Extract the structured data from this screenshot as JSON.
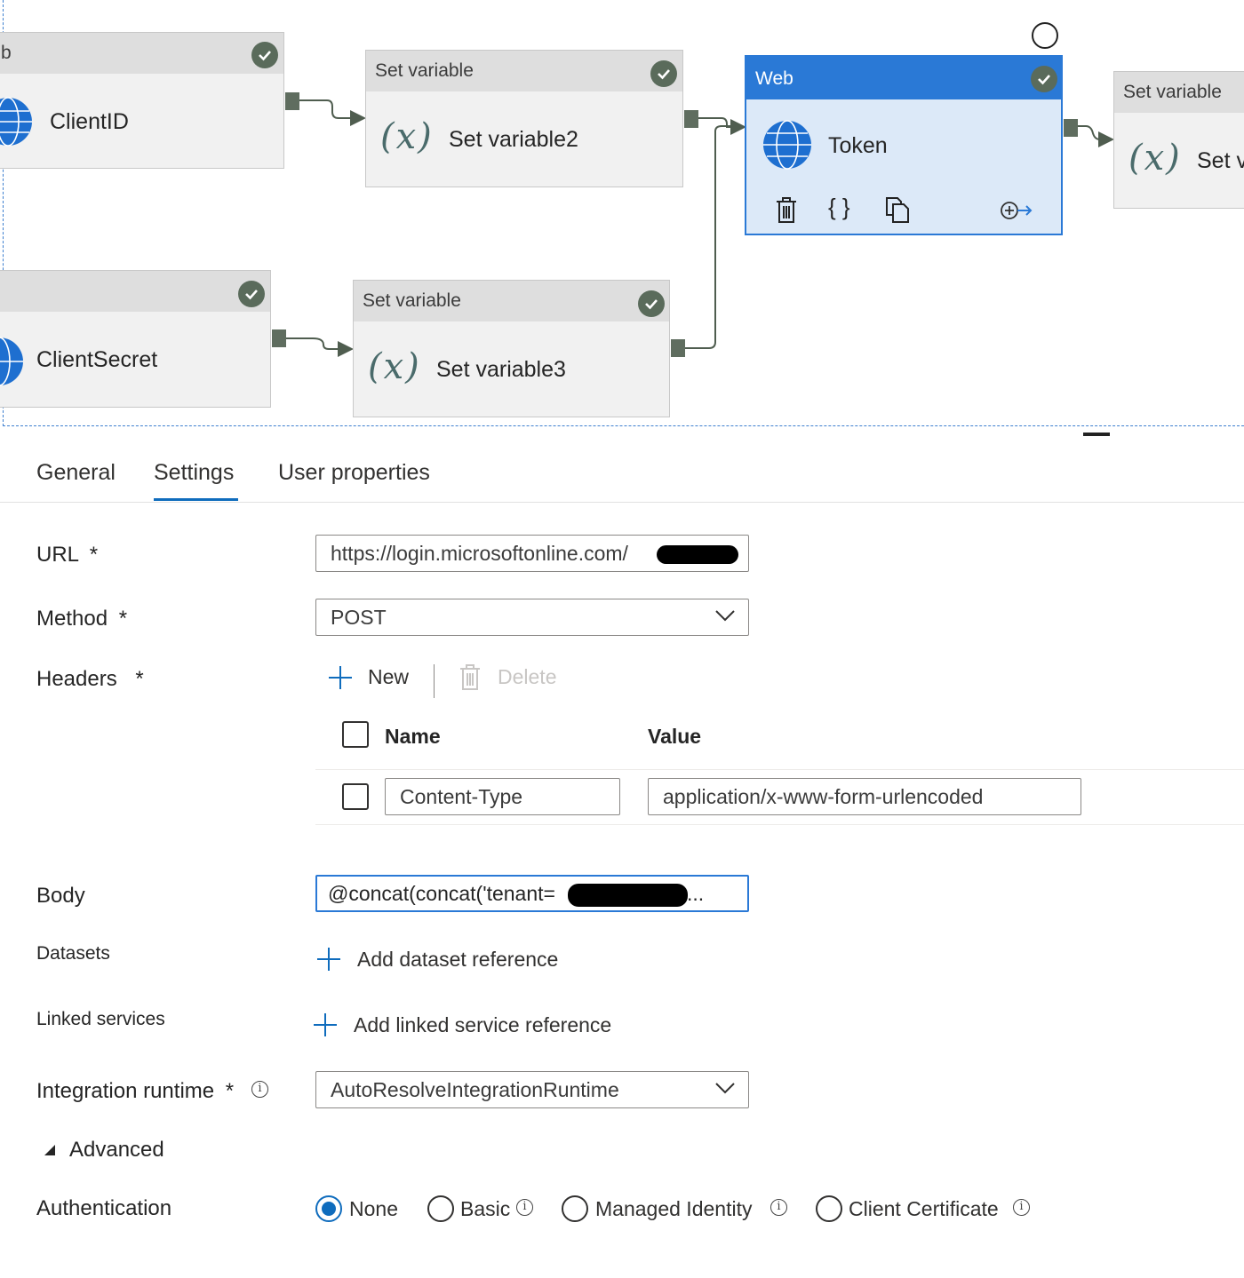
{
  "canvas": {
    "nodes": {
      "clientid": {
        "type": "b",
        "name": "ClientID"
      },
      "setvar2": {
        "type": "Set variable",
        "name": "Set variable2"
      },
      "token": {
        "type": "Web",
        "name": "Token"
      },
      "setvar4": {
        "type": "Set variable",
        "name": "Set v"
      },
      "clientsecret": {
        "name": "ClientSecret"
      },
      "setvar3": {
        "type": "Set variable",
        "name": "Set variable3"
      }
    },
    "var_symbol": "(x)"
  },
  "tabs": [
    {
      "label": "General"
    },
    {
      "label": "Settings",
      "active": true
    },
    {
      "label": "User properties"
    }
  ],
  "form": {
    "url": {
      "label": "URL",
      "required": "*",
      "value": "https://login.microsoftonline.com/"
    },
    "method": {
      "label": "Method",
      "required": "*",
      "value": "POST"
    },
    "headers": {
      "label": "Headers",
      "required": "*",
      "new_label": "New",
      "delete_label": "Delete",
      "col_name": "Name",
      "col_value": "Value",
      "rows": [
        {
          "name": "Content-Type",
          "value": "application/x-www-form-urlencoded"
        }
      ]
    },
    "body": {
      "label": "Body",
      "value": "@concat(concat('tenant=",
      "ellipsis": "..."
    },
    "datasets": {
      "label": "Datasets",
      "action": "Add dataset reference"
    },
    "linked_services": {
      "label": "Linked services",
      "action": "Add linked service reference"
    },
    "integration_runtime": {
      "label": "Integration runtime",
      "required": "*",
      "value": "AutoResolveIntegrationRuntime"
    },
    "advanced": {
      "label": "Advanced"
    },
    "authentication": {
      "label": "Authentication",
      "options": [
        {
          "label": "None",
          "selected": true
        },
        {
          "label": "Basic"
        },
        {
          "label": "Managed Identity"
        },
        {
          "label": "Client Certificate"
        }
      ]
    }
  },
  "colors": {
    "accent": "#0f6cbd",
    "selected_node": "#2a79d6",
    "status_success": "#5a6b5b"
  }
}
